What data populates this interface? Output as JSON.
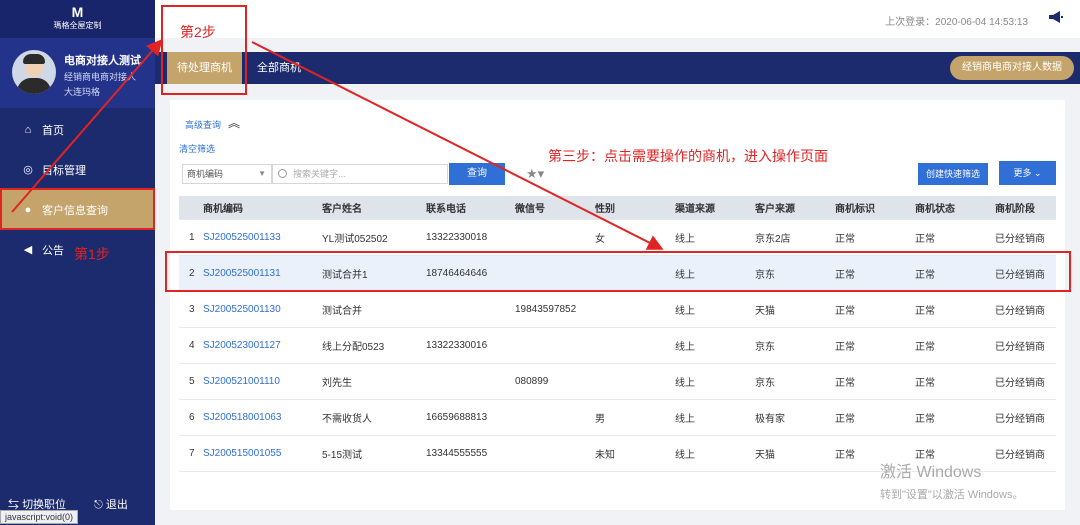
{
  "brand": {
    "mark": "M",
    "name": "瑪格全屋定制"
  },
  "user": {
    "name": "电商对接人测试",
    "role": "经销商电商对接人",
    "city": "大连玛格"
  },
  "nav": [
    {
      "label": "首页",
      "icon": "home-icon"
    },
    {
      "label": "目标管理",
      "icon": "target-icon"
    },
    {
      "label": "客户信息查询",
      "icon": "coin-icon"
    },
    {
      "label": "公告",
      "icon": "megaphone-icon"
    }
  ],
  "bottom": {
    "switch_label": "切换职位",
    "logout_label": "退出"
  },
  "status_url": "javascript:void(0)",
  "header": {
    "last_login": "上次登录：2020-06-04 14:53:13"
  },
  "tabs": [
    {
      "label": "待处理商机"
    },
    {
      "label": "全部商机"
    }
  ],
  "export_label": "经销商电商对接人数据",
  "filters": {
    "advanced_label": "高级查询",
    "clear_label": "清空筛选",
    "select_value": "商机编码",
    "search_placeholder": "搜索关键字...",
    "search_button": "查询",
    "quick_filter_button": "创建快速筛选",
    "more_button": "更多"
  },
  "table": {
    "headers": [
      "",
      "商机编码",
      "客户姓名",
      "联系电话",
      "微信号",
      "性别",
      "渠道来源",
      "客户来源",
      "商机标识",
      "商机状态",
      "商机阶段"
    ],
    "rows": [
      [
        "1",
        "SJ200525001133",
        "YL测试052502",
        "13322330018",
        "",
        "女",
        "线上",
        "京东2店",
        "正常",
        "正常",
        "已分经销商"
      ],
      [
        "2",
        "SJ200525001131",
        "测试合并1",
        "18746464646",
        "",
        "",
        "线上",
        "京东",
        "正常",
        "正常",
        "已分经销商"
      ],
      [
        "3",
        "SJ200525001130",
        "测试合并",
        "",
        "19843597852",
        "",
        "线上",
        "天猫",
        "正常",
        "正常",
        "已分经销商"
      ],
      [
        "4",
        "SJ200523001127",
        "线上分配0523",
        "13322330016",
        "",
        "",
        "线上",
        "京东",
        "正常",
        "正常",
        "已分经销商"
      ],
      [
        "5",
        "SJ200521001110",
        "刘先生",
        "",
        "080899",
        "",
        "线上",
        "京东",
        "正常",
        "正常",
        "已分经销商"
      ],
      [
        "6",
        "SJ200518001063",
        "不需收货人",
        "16659688813",
        "",
        "男",
        "线上",
        "极有家",
        "正常",
        "正常",
        "已分经销商"
      ],
      [
        "7",
        "SJ200515001055",
        "5-15测试",
        "13344555555",
        "",
        "未知",
        "线上",
        "天猫",
        "正常",
        "正常",
        "已分经销商"
      ]
    ]
  },
  "annotations": {
    "step1": "第1步",
    "step2": "第2步",
    "step3": "第三步：点击需要操作的商机，进入操作页面"
  },
  "watermark": {
    "line1": "激活 Windows",
    "line2": "转到\"设置\"以激活 Windows。"
  },
  "colors": {
    "sidebar": "#1c2a6e",
    "accent": "#c4a46a",
    "primary": "#2f6fd6",
    "annotation": "#e02424"
  }
}
